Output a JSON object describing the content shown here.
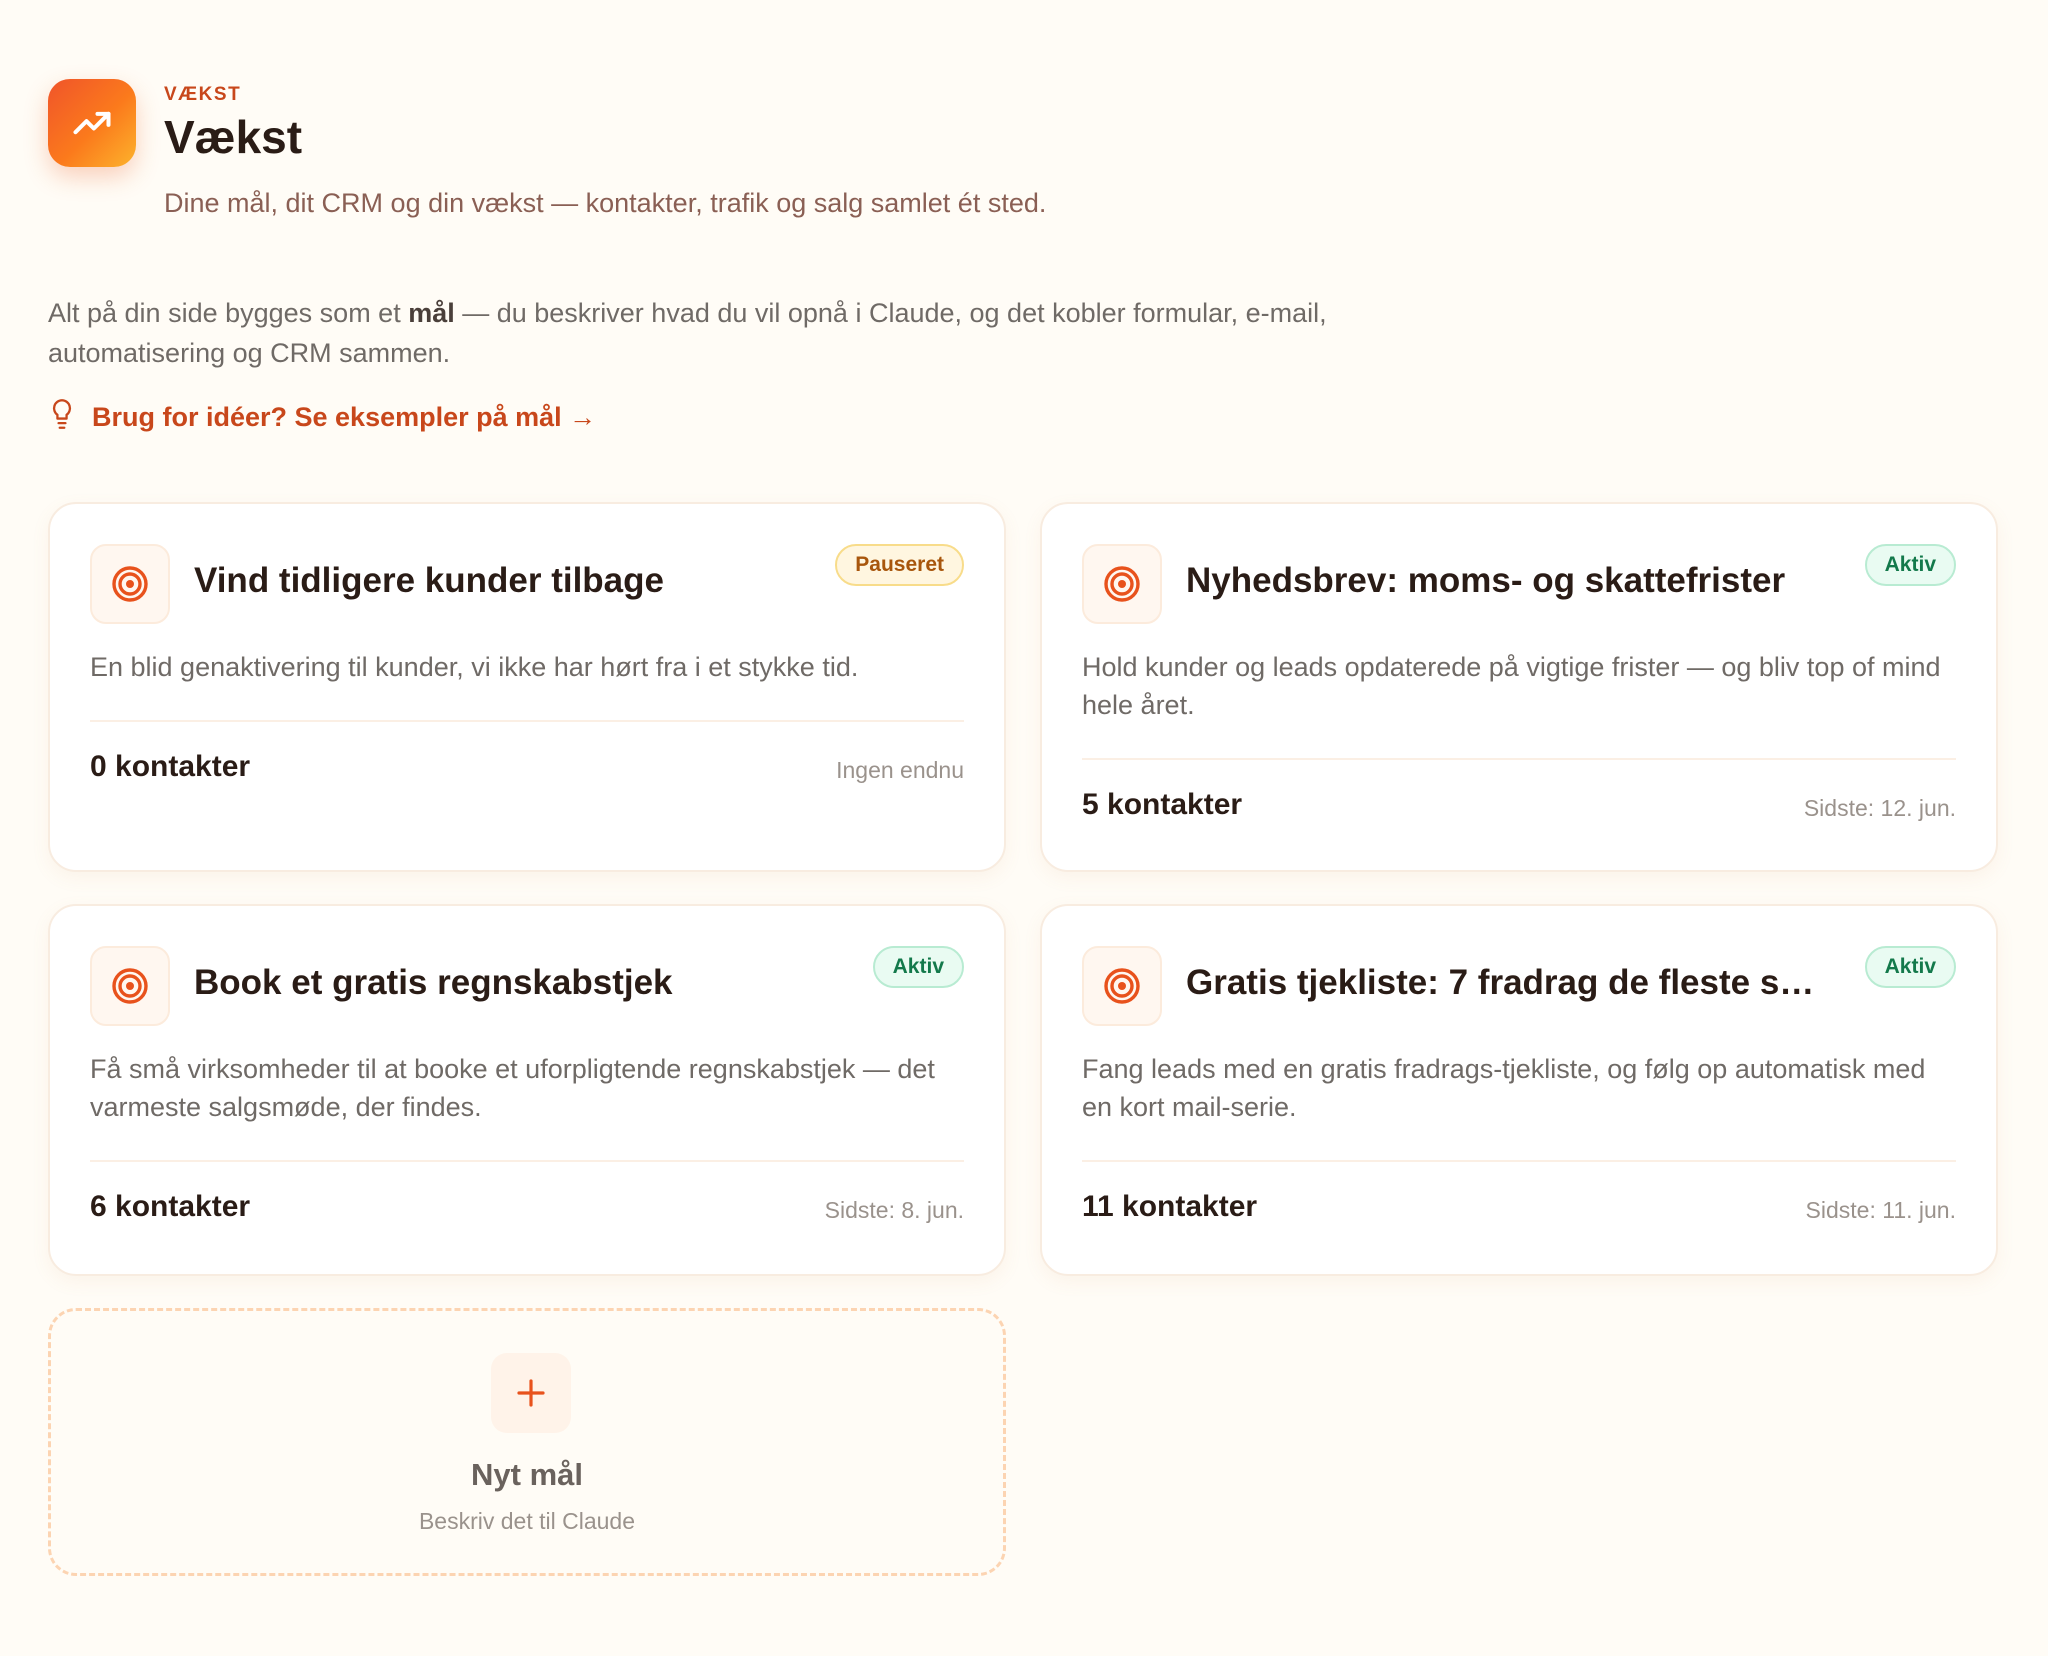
{
  "header": {
    "eyebrow": "VÆKST",
    "title": "Vækst",
    "subtitle": "Dine mål, dit CRM og din vækst — kontakter, trafik og salg samlet ét sted.",
    "icon": "trending-up-icon"
  },
  "intro": {
    "before": "Alt på din side bygges som et ",
    "bold": "mål",
    "after": " — du beskriver hvad du vil opnå i Claude, og det kobler formular, e-mail, automatisering og CRM sammen."
  },
  "ideas_link": {
    "label": "Brug for idéer? Se eksempler på mål →",
    "icon": "lightbulb-icon"
  },
  "goals": [
    {
      "title": "Vind tidligere kunder tilbage",
      "status": "Pauseret",
      "description": "En blid genaktivering til kunder, vi ikke har hørt fra i et stykke tid.",
      "contacts": "0 kontakter",
      "last": "Ingen endnu"
    },
    {
      "title": "Nyhedsbrev: moms- og skattefrister",
      "status": "Aktiv",
      "description": "Hold kunder og leads opdaterede på vigtige frister — og bliv top of mind hele året.",
      "contacts": "5 kontakter",
      "last": "Sidste: 12. jun."
    },
    {
      "title": "Book et gratis regnskabstjek",
      "status": "Aktiv",
      "description": "Få små virksomheder til at booke et uforpligtende regnskabstjek — det varmeste salgsmøde, der findes.",
      "contacts": "6 kontakter",
      "last": "Sidste: 8. jun."
    },
    {
      "title": "Gratis tjekliste: 7 fradrag de fleste sm...",
      "status": "Aktiv",
      "description": "Fang leads med en gratis fradrags-tjekliste, og følg op automatisk med en kort mail-serie.",
      "contacts": "11 kontakter",
      "last": "Sidste: 11. jun."
    }
  ],
  "new_goal": {
    "title": "Nyt mål",
    "subtitle": "Beskriv det til Claude"
  },
  "colors": {
    "accent": "#c8471b",
    "background": "#fffcf6",
    "active_badge": "#13794b",
    "paused_badge": "#a8560c"
  }
}
